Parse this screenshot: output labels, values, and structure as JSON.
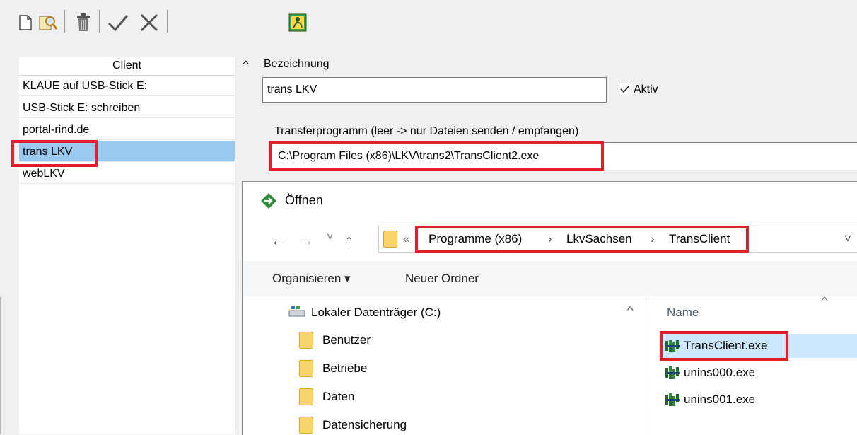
{
  "toolbar": {
    "items": [
      {
        "name": "new-document-icon"
      },
      {
        "name": "search-record-icon"
      },
      {
        "name": "delete-trash-icon"
      },
      {
        "name": "confirm-check-icon"
      },
      {
        "name": "cancel-x-icon"
      },
      {
        "name": "run-transfer-icon"
      }
    ]
  },
  "client_list": {
    "header": "Client",
    "items": [
      "KLAUE auf USB-Stick E:",
      "USB-Stick E: schreiben",
      "portal-rind.de",
      "trans LKV",
      "webLKV"
    ],
    "selected_index": 3
  },
  "form": {
    "collapse_glyph": "^",
    "bezeichnung_label": "Bezeichnung",
    "bezeichnung_value": "trans LKV",
    "aktiv_label": "Aktiv",
    "aktiv_checked": true,
    "transfer_label": "Transferprogramm (leer -> nur Dateien senden / empfangen)",
    "transfer_value": "C:\\Program Files (x86)\\LKV\\trans2\\TransClient2.exe"
  },
  "dialog": {
    "title": "Öffnen",
    "nav": {
      "back": "←",
      "forward": "→",
      "recent": "˅",
      "up": "↑",
      "overflow": "«"
    },
    "breadcrumb": [
      "Programme (x86)",
      "LkvSachsen",
      "TransClient"
    ],
    "breadcrumb_sep": "›",
    "address_dropdown": "˅",
    "commands": {
      "organize": "Organisieren ▾",
      "new_folder": "Neuer Ordner"
    },
    "tree": {
      "drive": "Lokaler Datenträger (C:)",
      "folders": [
        "Benutzer",
        "Betriebe",
        "Daten",
        "Datensicherung"
      ]
    },
    "files": {
      "column_header": "Name",
      "items": [
        "TransClient.exe",
        "unins000.exe",
        "unins001.exe"
      ],
      "selected_index": 0
    },
    "colors": {
      "selected_file": "#cce8ff",
      "highlight_red": "#e0202a",
      "accent_green": "#2e8b3a"
    }
  }
}
